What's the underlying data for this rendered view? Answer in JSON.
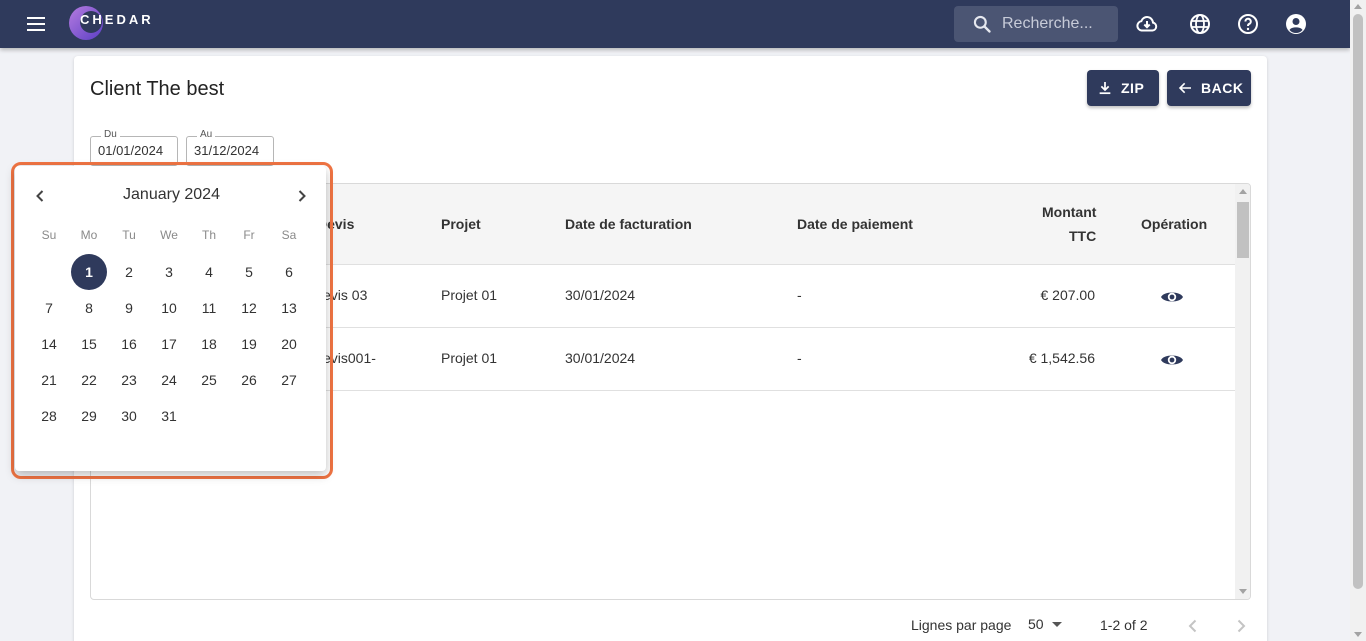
{
  "header": {
    "logo_text": "CHEDAR",
    "search_placeholder": "Recherche...",
    "icons": [
      "menu-icon",
      "cloud-download-icon",
      "globe-icon",
      "help-icon",
      "account-icon"
    ]
  },
  "page": {
    "title": "Client The best",
    "zip_label": "ZIP",
    "back_label": "BACK",
    "from_label": "Du",
    "from_value": "01/01/2024",
    "to_label": "Au",
    "to_value": "31/12/2024"
  },
  "table": {
    "columns": {
      "devis": "Devis",
      "projet": "Projet",
      "date_facturation": "Date de facturation",
      "date_paiement": "Date de paiement",
      "montant_l1": "Montant",
      "montant_l2": "TTC",
      "operation": "Opération"
    },
    "rows": [
      {
        "devis": "evis 03",
        "projet": "Projet 01",
        "date_facturation": "30/01/2024",
        "date_paiement": "-",
        "montant": "€ 207.00"
      },
      {
        "devis": "evis001-",
        "projet": "Projet 01",
        "date_facturation": "30/01/2024",
        "date_paiement": "-",
        "montant": "€ 1,542.56"
      }
    ]
  },
  "pagination": {
    "rows_per_page_label": "Lignes par page",
    "rows_per_page": "50",
    "range": "1-2 of 2"
  },
  "calendar": {
    "month_label": "January 2024",
    "weekdays": [
      "Su",
      "Mo",
      "Tu",
      "We",
      "Th",
      "Fr",
      "Sa"
    ],
    "first_weekday_index": 1,
    "days_in_month": 31,
    "selected_day": 1
  },
  "colors": {
    "primary": "#2f3a5c",
    "highlight": "#f07443"
  }
}
